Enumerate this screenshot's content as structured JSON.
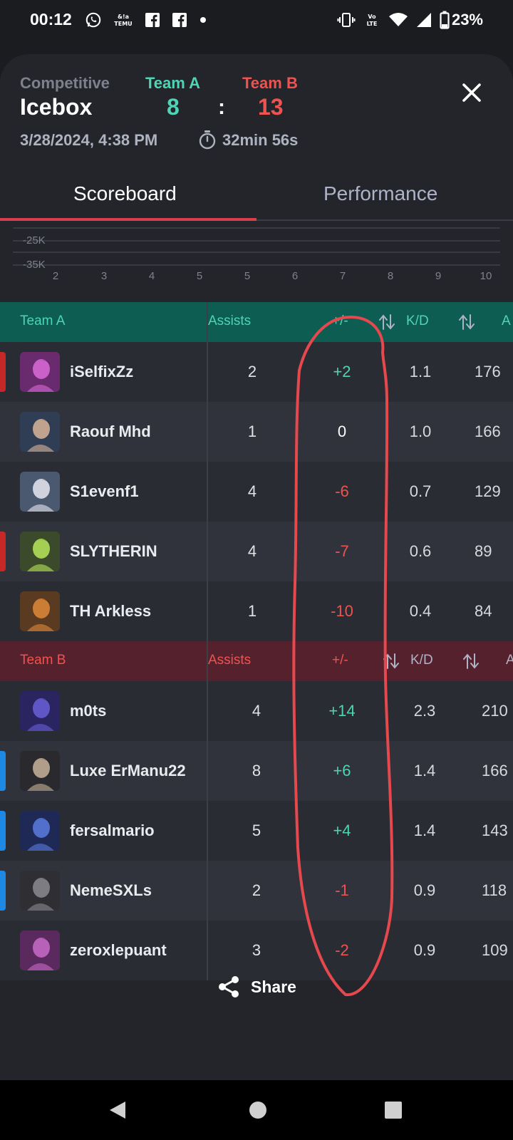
{
  "status_bar": {
    "time": "00:12",
    "battery": "23%",
    "left_icons": [
      "whatsapp-icon",
      "temu-icon",
      "facebook-icon",
      "facebook-icon",
      "dot-icon"
    ],
    "right_icons": [
      "vibrate-icon",
      "volte-icon",
      "wifi-icon",
      "signal-icon",
      "battery-icon"
    ]
  },
  "header": {
    "mode": "Competitive",
    "map": "Icebox",
    "team_a_label": "Team A",
    "team_b_label": "Team B",
    "score_a": "8",
    "score_sep": ":",
    "score_b": "13",
    "date": "3/28/2024, 4:38 PM",
    "duration": "32min 56s"
  },
  "tabs": {
    "scoreboard": "Scoreboard",
    "performance": "Performance",
    "active": "scoreboard"
  },
  "chart_strip": {
    "y_labels": [
      "-25K",
      "-35K"
    ],
    "x_labels": [
      "2",
      "3",
      "4",
      "5",
      "5",
      "6",
      "7",
      "8",
      "9",
      "10"
    ]
  },
  "columns": {
    "assists": "Assists",
    "plus_minus": "+/-",
    "kd": "K/D",
    "acs_partial": "A"
  },
  "team_a": {
    "name": "Team A",
    "players": [
      {
        "name": "iSelfixZz",
        "assists": "2",
        "pm": "+2",
        "pm_sign": "pos",
        "kd": "1.1",
        "acs": "176",
        "party": "red"
      },
      {
        "name": "Raouf Mhd",
        "assists": "1",
        "pm": "0",
        "pm_sign": "zero",
        "kd": "1.0",
        "acs": "166",
        "party": ""
      },
      {
        "name": "S1evenf1",
        "assists": "4",
        "pm": "-6",
        "pm_sign": "neg",
        "kd": "0.7",
        "acs": "129",
        "party": ""
      },
      {
        "name": "SLYTHERIN",
        "assists": "4",
        "pm": "-7",
        "pm_sign": "neg",
        "kd": "0.6",
        "acs": "89",
        "party": "red"
      },
      {
        "name": "TH Arkless",
        "assists": "1",
        "pm": "-10",
        "pm_sign": "neg",
        "kd": "0.4",
        "acs": "84",
        "party": ""
      }
    ]
  },
  "team_b": {
    "name": "Team B",
    "players": [
      {
        "name": "m0ts",
        "assists": "4",
        "pm": "+14",
        "pm_sign": "pos",
        "kd": "2.3",
        "acs": "210",
        "party": ""
      },
      {
        "name": "Luxe ErManu22",
        "assists": "8",
        "pm": "+6",
        "pm_sign": "pos",
        "kd": "1.4",
        "acs": "166",
        "party": "blue"
      },
      {
        "name": "fersalmario",
        "assists": "5",
        "pm": "+4",
        "pm_sign": "pos",
        "kd": "1.4",
        "acs": "143",
        "party": "blue"
      },
      {
        "name": "NemeSXLs",
        "assists": "2",
        "pm": "-1",
        "pm_sign": "neg",
        "kd": "0.9",
        "acs": "118",
        "party": "blue"
      },
      {
        "name": "zeroxlepuant",
        "assists": "3",
        "pm": "-2",
        "pm_sign": "neg",
        "kd": "0.9",
        "acs": "109",
        "party": ""
      }
    ]
  },
  "share": {
    "label": "Share"
  },
  "colors": {
    "team_a": "#4fd4b4",
    "team_b": "#ef5350",
    "party_red": "#c62828",
    "party_blue": "#1e88e5",
    "annotation": "#e5484d"
  }
}
